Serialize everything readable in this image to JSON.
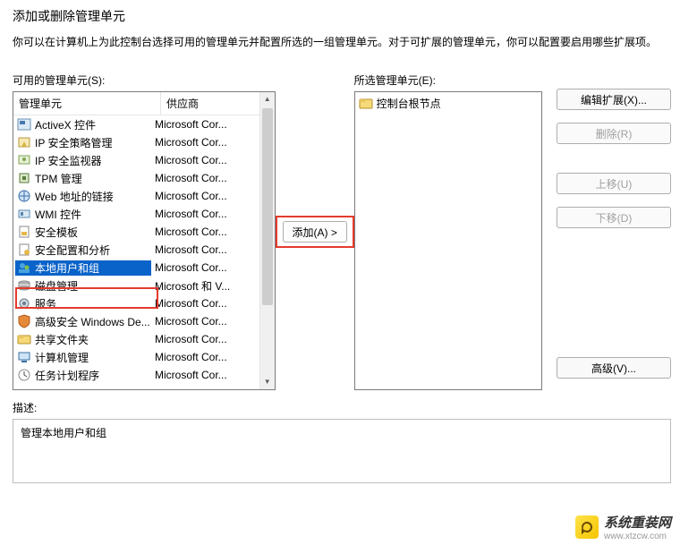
{
  "dialog": {
    "title": "添加或删除管理单元",
    "description": "你可以在计算机上为此控制台选择可用的管理单元并配置所选的一组管理单元。对于可扩展的管理单元，你可以配置要启用哪些扩展项。"
  },
  "available": {
    "label": "可用的管理单元(S):",
    "columns": {
      "name": "管理单元",
      "vendor": "供应商"
    },
    "items": [
      {
        "icon": "activex-icon",
        "name": "ActiveX 控件",
        "vendor": "Microsoft Cor..."
      },
      {
        "icon": "ipsec-policy-icon",
        "name": "IP 安全策略管理",
        "vendor": "Microsoft Cor..."
      },
      {
        "icon": "ipsec-monitor-icon",
        "name": "IP 安全监视器",
        "vendor": "Microsoft Cor..."
      },
      {
        "icon": "tpm-icon",
        "name": "TPM 管理",
        "vendor": "Microsoft Cor..."
      },
      {
        "icon": "web-link-icon",
        "name": "Web 地址的链接",
        "vendor": "Microsoft Cor..."
      },
      {
        "icon": "wmi-icon",
        "name": "WMI 控件",
        "vendor": "Microsoft Cor..."
      },
      {
        "icon": "sec-template-icon",
        "name": "安全模板",
        "vendor": "Microsoft Cor..."
      },
      {
        "icon": "sec-config-icon",
        "name": "安全配置和分析",
        "vendor": "Microsoft Cor..."
      },
      {
        "icon": "local-users-icon",
        "name": "本地用户和组",
        "vendor": "Microsoft Cor...",
        "selected": true
      },
      {
        "icon": "disk-mgmt-icon",
        "name": "磁盘管理",
        "vendor": "Microsoft 和 V..."
      },
      {
        "icon": "services-icon",
        "name": "服务",
        "vendor": "Microsoft Cor..."
      },
      {
        "icon": "adv-firewall-icon",
        "name": "高级安全 Windows De...",
        "vendor": "Microsoft Cor..."
      },
      {
        "icon": "shared-folders-icon",
        "name": "共享文件夹",
        "vendor": "Microsoft Cor..."
      },
      {
        "icon": "computer-mgmt-icon",
        "name": "计算机管理",
        "vendor": "Microsoft Cor..."
      },
      {
        "icon": "task-sched-icon",
        "name": "任务计划程序",
        "vendor": "Microsoft Cor..."
      }
    ]
  },
  "selected": {
    "label": "所选管理单元(E):",
    "root": {
      "icon": "console-root-icon",
      "name": "控制台根节点"
    }
  },
  "buttons": {
    "add": "添加(A) >",
    "edit_ext": "编辑扩展(X)...",
    "remove": "删除(R)",
    "move_up": "上移(U)",
    "move_down": "下移(D)",
    "advanced": "高级(V)..."
  },
  "description_section": {
    "label": "描述:",
    "text": "管理本地用户和组"
  },
  "watermark": {
    "cn": "系统重装网",
    "en": "www.xtzcw.com"
  },
  "colors": {
    "highlight": "#e53b2e",
    "selection": "#0a63c9"
  }
}
